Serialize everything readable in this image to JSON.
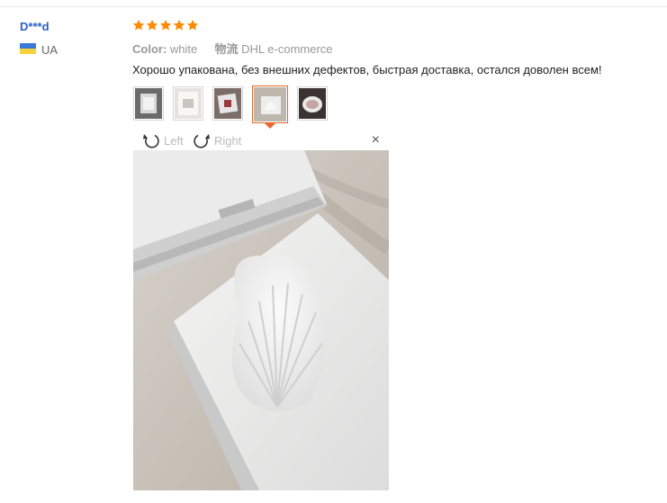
{
  "reviewer": {
    "name": "D***d",
    "country": "UA"
  },
  "rating": {
    "value": 5,
    "max": 5
  },
  "meta": {
    "color_label": "Color:",
    "color_value": "white",
    "shipping_label": "物流",
    "shipping_value": "DHL e-commerce"
  },
  "review": {
    "text": "Хорошо упакована, без внешних дефектов, быстрая доставка, остался доволен всем!"
  },
  "thumbnails": {
    "count": 5,
    "selected": 4
  },
  "viewer": {
    "rotate_left": "Left",
    "rotate_right": "Right",
    "close": "×"
  },
  "colors": {
    "link": "#2a62c9",
    "star": "#ff8a00",
    "accent": "#e8682a",
    "muted": "#999999",
    "text": "#222222"
  }
}
